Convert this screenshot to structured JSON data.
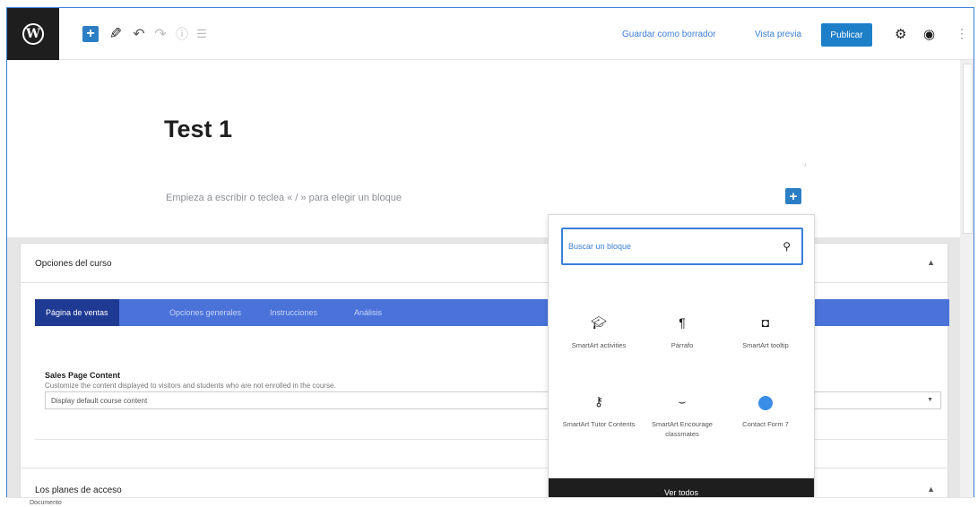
{
  "toolbar": {
    "save_draft": "Guardar como borrador",
    "preview": "Vista previa",
    "publish": "Publicar",
    "add_label": "+"
  },
  "post": {
    "title": "Test 1",
    "placeholder": "Empieza a escribir o teclea « / » para elegir un bloque"
  },
  "meta": {
    "course_options_title": "Opciones del curso",
    "tabs": [
      {
        "label": "Página de ventas",
        "active": true
      },
      {
        "label": "Opciones generales",
        "active": false
      },
      {
        "label": "Instrucciones",
        "active": false
      },
      {
        "label": "Análisis",
        "active": false
      }
    ],
    "sales_field": {
      "label": "Sales Page Content",
      "description": "Customize the content displayed to visitors and students who are not enrolled in the course.",
      "selected": "Display default course content"
    },
    "access_plans_title": "Los planes de acceso"
  },
  "inserter": {
    "search_placeholder": "Buscar un bloque",
    "blocks": [
      {
        "label": "SmartArt activities",
        "icon": "graduation-cap-icon"
      },
      {
        "label": "Párrafo",
        "icon": "paragraph-icon"
      },
      {
        "label": "SmartArt tooltip",
        "icon": "tooltip-icon"
      },
      {
        "label": "SmartArt Tutor Contents",
        "icon": "key-icon"
      },
      {
        "label": "SmartArt Encourage classmates",
        "icon": "smile-icon"
      },
      {
        "label": "Contact Form 7",
        "icon": "contact-form-icon"
      }
    ],
    "view_all": "Ver todos"
  },
  "footer": {
    "label": "Documento"
  },
  "colors": {
    "accent": "#1e7fc9",
    "tab_bar": "#4a72d9",
    "tab_active": "#1f3a93"
  }
}
